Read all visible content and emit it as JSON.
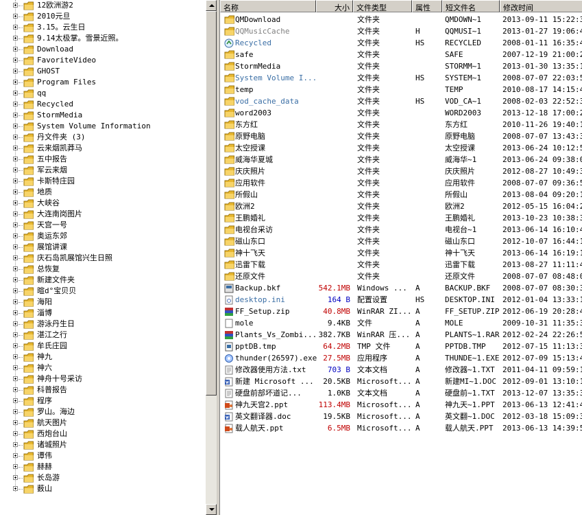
{
  "tree": {
    "items": [
      "12欧洲游2",
      "2010元旦",
      "3.15。云生日",
      "9.14太极掌。雪景近照。",
      "Download",
      "FavoriteVideo",
      "GHOST",
      "Program Files",
      "qq",
      "Recycled",
      "StormMedia",
      "System Volume Information",
      "丹文件夹 (3)",
      "云来烟凯莽马",
      "五中报告",
      "军云来烟",
      "卡斯特庄园",
      "地质",
      "大峡谷",
      "大连南岗图片",
      "天宫一号",
      "奥运东郊",
      "展馆讲课",
      "庆石岛凯展馆兴生日照",
      "总恢复",
      "新建文件夹",
      "暄d°宝贝贝",
      "海阳",
      "淄博",
      "游泳丹生日",
      "湛江之行",
      "牟氏庄园",
      "神九",
      "神六",
      "神舟十号采访",
      "科普报告",
      "程序",
      "罗山。海边",
      "航天图片",
      "西炮台山",
      "诸城照片",
      "谭伟",
      "赫赫",
      "长岛游",
      "薮山"
    ]
  },
  "list": {
    "columns": {
      "name": "名称",
      "size": "大小",
      "type": "文件类型",
      "attr": "属性",
      "short": "短文件名",
      "modified": "修改时间"
    },
    "rows": [
      {
        "name": "QMDownload",
        "size": "",
        "type": "文件夹",
        "attr": "",
        "short": "QMDOWN~1",
        "modified": "2013-09-11 15:22:30",
        "icon": "folder-icon",
        "style": ""
      },
      {
        "name": "QQMusicCache",
        "size": "",
        "type": "文件夹",
        "attr": "H",
        "short": "QQMUSI~1",
        "modified": "2013-01-27 19:06:44",
        "icon": "folder-icon",
        "style": "grey"
      },
      {
        "name": "Recycled",
        "size": "",
        "type": "文件夹",
        "attr": "HS",
        "short": "RECYCLED",
        "modified": "2008-01-11 16:35:40",
        "icon": "recycle-icon",
        "style": "sys"
      },
      {
        "name": "safe",
        "size": "",
        "type": "文件夹",
        "attr": "",
        "short": "SAFE",
        "modified": "2007-12-19 21:00:22",
        "icon": "folder-icon",
        "style": ""
      },
      {
        "name": "StormMedia",
        "size": "",
        "type": "文件夹",
        "attr": "",
        "short": "STORMM~1",
        "modified": "2013-01-30 13:35:18",
        "icon": "folder-icon",
        "style": ""
      },
      {
        "name": "System Volume I...",
        "size": "",
        "type": "文件夹",
        "attr": "HS",
        "short": "SYSTEM~1",
        "modified": "2008-07-07 22:03:50",
        "icon": "folder-icon",
        "style": "sys"
      },
      {
        "name": "temp",
        "size": "",
        "type": "文件夹",
        "attr": "",
        "short": "TEMP",
        "modified": "2010-08-17 14:15:48",
        "icon": "folder-icon",
        "style": ""
      },
      {
        "name": "vod_cache_data",
        "size": "",
        "type": "文件夹",
        "attr": "HS",
        "short": "VOD_CA~1",
        "modified": "2008-02-03 22:52:30",
        "icon": "folder-icon",
        "style": "sys"
      },
      {
        "name": "word2003",
        "size": "",
        "type": "文件夹",
        "attr": "",
        "short": "WORD2003",
        "modified": "2013-12-18 17:00:22",
        "icon": "folder-icon",
        "style": ""
      },
      {
        "name": "东方红",
        "size": "",
        "type": "文件夹",
        "attr": "",
        "short": "东方红",
        "modified": "2010-11-26 19:40:16",
        "icon": "folder-icon",
        "style": ""
      },
      {
        "name": "原野电脑",
        "size": "",
        "type": "文件夹",
        "attr": "",
        "short": "原野电脑",
        "modified": "2008-07-07 13:43:30",
        "icon": "folder-icon",
        "style": ""
      },
      {
        "name": "太空授课",
        "size": "",
        "type": "文件夹",
        "attr": "",
        "short": "太空授课",
        "modified": "2013-06-24 10:12:56",
        "icon": "folder-icon",
        "style": ""
      },
      {
        "name": "威海华夏城",
        "size": "",
        "type": "文件夹",
        "attr": "",
        "short": "威海华~1",
        "modified": "2013-06-24 09:38:02",
        "icon": "folder-icon",
        "style": ""
      },
      {
        "name": "庆庆照片",
        "size": "",
        "type": "文件夹",
        "attr": "",
        "short": "庆庆照片",
        "modified": "2012-08-27 10:49:38",
        "icon": "folder-icon",
        "style": ""
      },
      {
        "name": "应用软件",
        "size": "",
        "type": "文件夹",
        "attr": "",
        "short": "应用软件",
        "modified": "2008-07-07 09:36:52",
        "icon": "folder-icon",
        "style": ""
      },
      {
        "name": "所假山",
        "size": "",
        "type": "文件夹",
        "attr": "",
        "short": "所假山",
        "modified": "2013-08-04 09:20:14",
        "icon": "folder-icon",
        "style": ""
      },
      {
        "name": "欧洲2",
        "size": "",
        "type": "文件夹",
        "attr": "",
        "short": "欧洲2",
        "modified": "2012-05-15 16:04:26",
        "icon": "folder-icon",
        "style": ""
      },
      {
        "name": "王鹏婚礼",
        "size": "",
        "type": "文件夹",
        "attr": "",
        "short": "王鹏婚礼",
        "modified": "2013-10-23 10:38:34",
        "icon": "folder-icon",
        "style": ""
      },
      {
        "name": "电视台采访",
        "size": "",
        "type": "文件夹",
        "attr": "",
        "short": "电视台~1",
        "modified": "2013-06-14 16:10:42",
        "icon": "folder-icon",
        "style": ""
      },
      {
        "name": "磁山东口",
        "size": "",
        "type": "文件夹",
        "attr": "",
        "short": "磁山东口",
        "modified": "2012-10-07 16:44:18",
        "icon": "folder-icon",
        "style": ""
      },
      {
        "name": "神十飞天",
        "size": "",
        "type": "文件夹",
        "attr": "",
        "short": "神十飞天",
        "modified": "2013-06-14 16:19:14",
        "icon": "folder-icon",
        "style": ""
      },
      {
        "name": "迅雷下载",
        "size": "",
        "type": "文件夹",
        "attr": "",
        "short": "迅雷下载",
        "modified": "2013-08-27 11:11:44",
        "icon": "folder-icon",
        "style": ""
      },
      {
        "name": "还原文件",
        "size": "",
        "type": "文件夹",
        "attr": "",
        "short": "还原文件",
        "modified": "2008-07-07 08:48:08",
        "icon": "folder-icon",
        "style": ""
      },
      {
        "name": "Backup.bkf",
        "size": "542.1MB",
        "type": "Windows ...",
        "attr": "A",
        "short": "BACKUP.BKF",
        "modified": "2008-07-07 08:30:32",
        "icon": "backup-icon",
        "style": "",
        "sizeStyle": "red"
      },
      {
        "name": "desktop.ini",
        "size": "164 B",
        "type": "配置设置",
        "attr": "HS",
        "short": "DESKTOP.INI",
        "modified": "2012-01-04 13:33:18",
        "icon": "settings-file-icon",
        "style": "sys",
        "sizeStyle": "blue"
      },
      {
        "name": "FF_Setup.zip",
        "size": "40.8MB",
        "type": "WinRAR ZI...",
        "attr": "A",
        "short": "FF_SETUP.ZIP",
        "modified": "2012-06-19 20:28:46",
        "icon": "archive-icon",
        "style": "",
        "sizeStyle": "red"
      },
      {
        "name": "mole",
        "size": "9.4KB",
        "type": "文件",
        "attr": "A",
        "short": "MOLE",
        "modified": "2009-10-31 11:35:34",
        "icon": "file-icon",
        "style": "",
        "sizeStyle": ""
      },
      {
        "name": "Plants_Vs_Zombi...",
        "size": "382.7KB",
        "type": "WinRAR 压...",
        "attr": "A",
        "short": "PLANTS~1.RAR",
        "modified": "2012-02-24 22:26:50",
        "icon": "archive-icon",
        "style": "",
        "sizeStyle": ""
      },
      {
        "name": "pptDB.tmp",
        "size": "64.2MB",
        "type": "TMP 文件",
        "attr": "A",
        "short": "PPTDB.TMP",
        "modified": "2012-07-15 11:13:30",
        "icon": "tmp-file-icon",
        "style": "",
        "sizeStyle": "red"
      },
      {
        "name": "thunder(26597).exe",
        "size": "27.5MB",
        "type": "应用程序",
        "attr": "A",
        "short": "THUNDE~1.EXE",
        "modified": "2012-07-09 15:13:46",
        "icon": "exe-icon",
        "style": "",
        "sizeStyle": "red"
      },
      {
        "name": "修改器使用方法.txt",
        "size": "703 B",
        "type": "文本文档",
        "attr": "A",
        "short": "修改器~1.TXT",
        "modified": "2011-04-11 09:59:12",
        "icon": "text-file-icon",
        "style": "",
        "sizeStyle": "blue"
      },
      {
        "name": "新建 Microsoft ...",
        "size": "20.5KB",
        "type": "Microsoft...",
        "attr": "A",
        "short": "新建MI~1.DOC",
        "modified": "2012-09-01 13:10:16",
        "icon": "word-icon",
        "style": "",
        "sizeStyle": ""
      },
      {
        "name": "硬盘前部坏道记...",
        "size": "1.0KB",
        "type": "文本文档",
        "attr": "A",
        "short": "硬盘前~1.TXT",
        "modified": "2013-12-07 13:35:36",
        "icon": "text-file-icon",
        "style": "",
        "sizeStyle": ""
      },
      {
        "name": "神九天宫2.ppt",
        "size": "113.4MB",
        "type": "Microsoft...",
        "attr": "A",
        "short": "神九天~1.PPT",
        "modified": "2013-06-13 12:41:40",
        "icon": "ppt-icon",
        "style": "",
        "sizeStyle": "red"
      },
      {
        "name": "英文翻译器.doc",
        "size": "19.5KB",
        "type": "Microsoft...",
        "attr": "A",
        "short": "英文翻~1.DOC",
        "modified": "2012-03-18 15:09:38",
        "icon": "word-icon",
        "style": "",
        "sizeStyle": ""
      },
      {
        "name": "载人航天.ppt",
        "size": "6.5MB",
        "type": "Microsoft...",
        "attr": "A",
        "short": "载人航天.PPT",
        "modified": "2013-06-13 14:39:56",
        "icon": "ppt-icon",
        "style": "",
        "sizeStyle": "red"
      }
    ]
  },
  "colors": {
    "panel": "#d4d0c8",
    "folder": "#f0c040",
    "system_text": "#3a6ea5",
    "big_size": "#c00000",
    "small_size": "#0000c0"
  }
}
